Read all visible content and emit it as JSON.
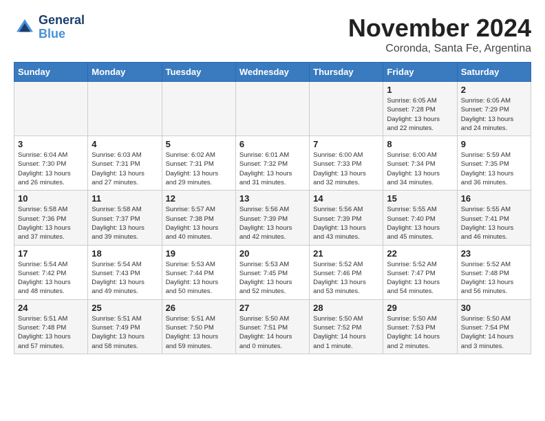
{
  "header": {
    "logo_line1": "General",
    "logo_line2": "Blue",
    "month": "November 2024",
    "location": "Coronda, Santa Fe, Argentina"
  },
  "weekdays": [
    "Sunday",
    "Monday",
    "Tuesday",
    "Wednesday",
    "Thursday",
    "Friday",
    "Saturday"
  ],
  "weeks": [
    [
      {
        "day": "",
        "info": ""
      },
      {
        "day": "",
        "info": ""
      },
      {
        "day": "",
        "info": ""
      },
      {
        "day": "",
        "info": ""
      },
      {
        "day": "",
        "info": ""
      },
      {
        "day": "1",
        "info": "Sunrise: 6:05 AM\nSunset: 7:28 PM\nDaylight: 13 hours\nand 22 minutes."
      },
      {
        "day": "2",
        "info": "Sunrise: 6:05 AM\nSunset: 7:29 PM\nDaylight: 13 hours\nand 24 minutes."
      }
    ],
    [
      {
        "day": "3",
        "info": "Sunrise: 6:04 AM\nSunset: 7:30 PM\nDaylight: 13 hours\nand 26 minutes."
      },
      {
        "day": "4",
        "info": "Sunrise: 6:03 AM\nSunset: 7:31 PM\nDaylight: 13 hours\nand 27 minutes."
      },
      {
        "day": "5",
        "info": "Sunrise: 6:02 AM\nSunset: 7:31 PM\nDaylight: 13 hours\nand 29 minutes."
      },
      {
        "day": "6",
        "info": "Sunrise: 6:01 AM\nSunset: 7:32 PM\nDaylight: 13 hours\nand 31 minutes."
      },
      {
        "day": "7",
        "info": "Sunrise: 6:00 AM\nSunset: 7:33 PM\nDaylight: 13 hours\nand 32 minutes."
      },
      {
        "day": "8",
        "info": "Sunrise: 6:00 AM\nSunset: 7:34 PM\nDaylight: 13 hours\nand 34 minutes."
      },
      {
        "day": "9",
        "info": "Sunrise: 5:59 AM\nSunset: 7:35 PM\nDaylight: 13 hours\nand 36 minutes."
      }
    ],
    [
      {
        "day": "10",
        "info": "Sunrise: 5:58 AM\nSunset: 7:36 PM\nDaylight: 13 hours\nand 37 minutes."
      },
      {
        "day": "11",
        "info": "Sunrise: 5:58 AM\nSunset: 7:37 PM\nDaylight: 13 hours\nand 39 minutes."
      },
      {
        "day": "12",
        "info": "Sunrise: 5:57 AM\nSunset: 7:38 PM\nDaylight: 13 hours\nand 40 minutes."
      },
      {
        "day": "13",
        "info": "Sunrise: 5:56 AM\nSunset: 7:39 PM\nDaylight: 13 hours\nand 42 minutes."
      },
      {
        "day": "14",
        "info": "Sunrise: 5:56 AM\nSunset: 7:39 PM\nDaylight: 13 hours\nand 43 minutes."
      },
      {
        "day": "15",
        "info": "Sunrise: 5:55 AM\nSunset: 7:40 PM\nDaylight: 13 hours\nand 45 minutes."
      },
      {
        "day": "16",
        "info": "Sunrise: 5:55 AM\nSunset: 7:41 PM\nDaylight: 13 hours\nand 46 minutes."
      }
    ],
    [
      {
        "day": "17",
        "info": "Sunrise: 5:54 AM\nSunset: 7:42 PM\nDaylight: 13 hours\nand 48 minutes."
      },
      {
        "day": "18",
        "info": "Sunrise: 5:54 AM\nSunset: 7:43 PM\nDaylight: 13 hours\nand 49 minutes."
      },
      {
        "day": "19",
        "info": "Sunrise: 5:53 AM\nSunset: 7:44 PM\nDaylight: 13 hours\nand 50 minutes."
      },
      {
        "day": "20",
        "info": "Sunrise: 5:53 AM\nSunset: 7:45 PM\nDaylight: 13 hours\nand 52 minutes."
      },
      {
        "day": "21",
        "info": "Sunrise: 5:52 AM\nSunset: 7:46 PM\nDaylight: 13 hours\nand 53 minutes."
      },
      {
        "day": "22",
        "info": "Sunrise: 5:52 AM\nSunset: 7:47 PM\nDaylight: 13 hours\nand 54 minutes."
      },
      {
        "day": "23",
        "info": "Sunrise: 5:52 AM\nSunset: 7:48 PM\nDaylight: 13 hours\nand 56 minutes."
      }
    ],
    [
      {
        "day": "24",
        "info": "Sunrise: 5:51 AM\nSunset: 7:48 PM\nDaylight: 13 hours\nand 57 minutes."
      },
      {
        "day": "25",
        "info": "Sunrise: 5:51 AM\nSunset: 7:49 PM\nDaylight: 13 hours\nand 58 minutes."
      },
      {
        "day": "26",
        "info": "Sunrise: 5:51 AM\nSunset: 7:50 PM\nDaylight: 13 hours\nand 59 minutes."
      },
      {
        "day": "27",
        "info": "Sunrise: 5:50 AM\nSunset: 7:51 PM\nDaylight: 14 hours\nand 0 minutes."
      },
      {
        "day": "28",
        "info": "Sunrise: 5:50 AM\nSunset: 7:52 PM\nDaylight: 14 hours\nand 1 minute."
      },
      {
        "day": "29",
        "info": "Sunrise: 5:50 AM\nSunset: 7:53 PM\nDaylight: 14 hours\nand 2 minutes."
      },
      {
        "day": "30",
        "info": "Sunrise: 5:50 AM\nSunset: 7:54 PM\nDaylight: 14 hours\nand 3 minutes."
      }
    ]
  ]
}
